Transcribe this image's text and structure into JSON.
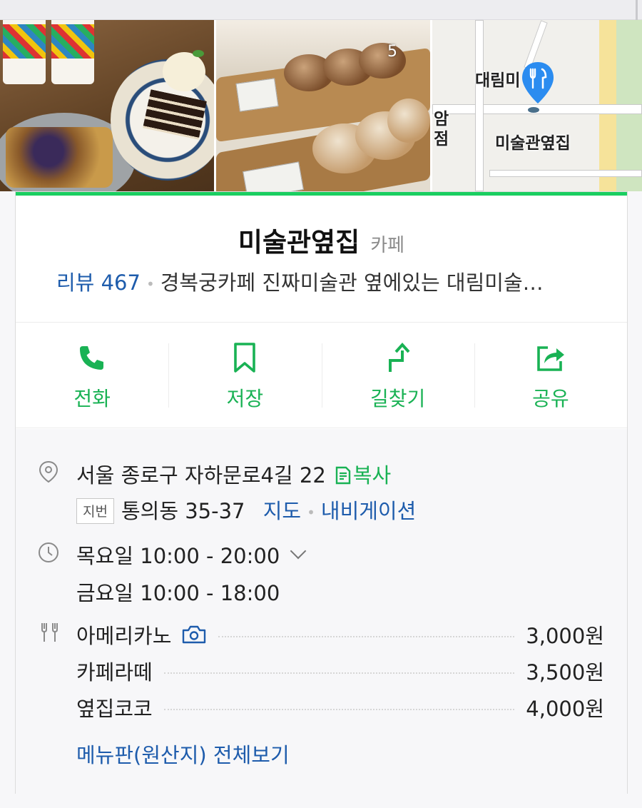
{
  "photos": {
    "count_label": "5",
    "map": {
      "label_top": "대림미",
      "label_side": "암\n점",
      "label_place": "미술관옆집"
    }
  },
  "place": {
    "name": "미술관옆집",
    "category": "카페",
    "review_label": "리뷰 467",
    "description": "경복궁카페 진짜미술관 옆에있는 대림미술…"
  },
  "actions": [
    {
      "label": "전화",
      "icon": "phone-icon"
    },
    {
      "label": "저장",
      "icon": "bookmark-icon"
    },
    {
      "label": "길찾기",
      "icon": "directions-icon"
    },
    {
      "label": "공유",
      "icon": "share-icon"
    }
  ],
  "address": {
    "road": "서울 종로구 자하문로4길 22",
    "copy_label": "복사",
    "jibeon_tag": "지번",
    "jibeon": "통의동 35-37",
    "map_link": "지도",
    "nav_link": "내비게이션"
  },
  "hours": {
    "line1": "목요일 10:00 - 20:00",
    "line2": "금요일 10:00 - 18:00"
  },
  "menu": {
    "items": [
      {
        "name": "아메리카노",
        "price": "3,000원"
      },
      {
        "name": "카페라떼",
        "price": "3,500원"
      },
      {
        "name": "옆집코코",
        "price": "4,000원"
      }
    ],
    "view_all": "메뉴판(원산지) 전체보기"
  },
  "colors": {
    "accent_green": "#19ce60",
    "link_blue": "#1e5cac",
    "map_pin_blue": "#2b8cf0"
  }
}
